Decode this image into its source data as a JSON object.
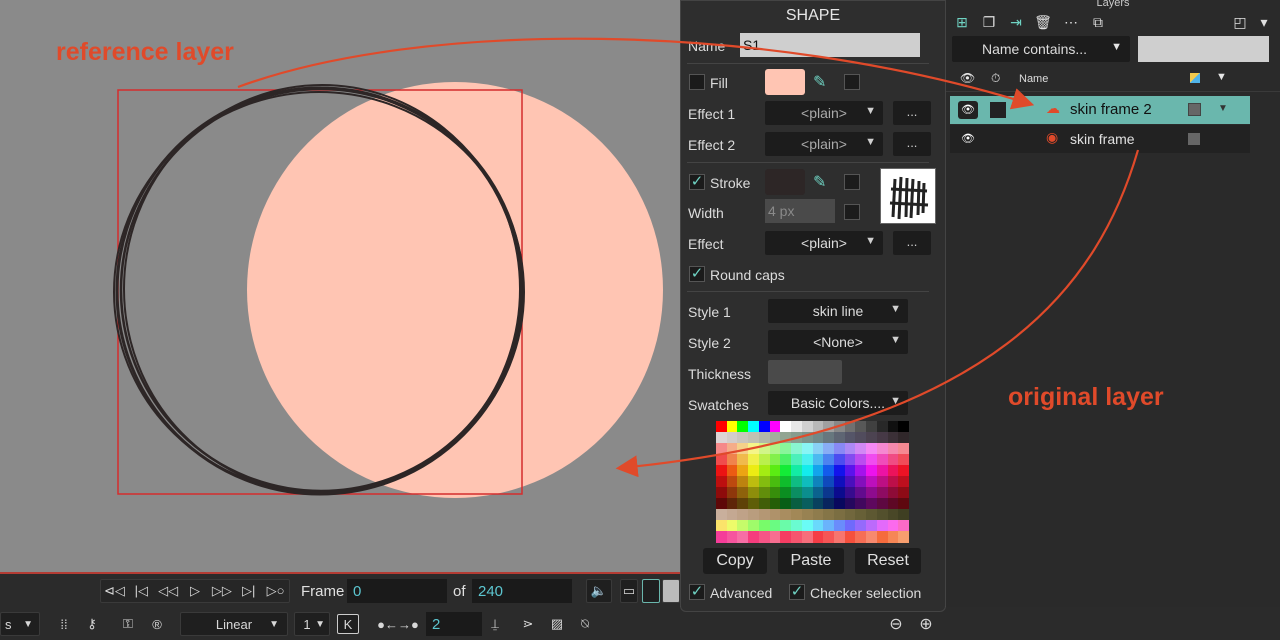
{
  "canvas": {
    "annotation_reference": "reference layer",
    "annotation_original": "original layer"
  },
  "shape_panel": {
    "title": "SHAPE",
    "name_label": "Name",
    "name_value": "S1",
    "fill_label": "Fill",
    "fill_color": "#ffc5b3",
    "fill_checked": false,
    "effect1_label": "Effect 1",
    "effect1_value": "<plain>",
    "effect2_label": "Effect 2",
    "effect2_value": "<plain>",
    "more_label": "...",
    "stroke_label": "Stroke",
    "stroke_checked": true,
    "stroke_color": "#2d2626",
    "width_label": "Width",
    "width_placeholder": "4 px",
    "effect_label": "Effect",
    "effect_value": "<plain>",
    "round_caps_label": "Round caps",
    "style1_label": "Style 1",
    "style1_value": "skin line",
    "style2_label": "Style 2",
    "style2_value": "<None>",
    "thickness_label": "Thickness",
    "swatches_label": "Swatches",
    "swatches_value": "Basic Colors....",
    "copy_label": "Copy",
    "paste_label": "Paste",
    "reset_label": "Reset",
    "advanced_label": "Advanced",
    "checker_label": "Checker selection"
  },
  "layers_panel": {
    "title": "Layers",
    "filter_label": "Name contains...",
    "filter_value": "",
    "name_header": "Name",
    "layers": [
      {
        "name": "skin frame 2",
        "selected": true,
        "accent": "#6ab7ad"
      },
      {
        "name": "skin frame",
        "selected": false
      }
    ]
  },
  "timeline": {
    "frame_label": "Frame",
    "frame_value": "0",
    "of_label": "of",
    "total_frames": "240"
  },
  "bottom_toolbar": {
    "left_label": "s",
    "interpolation": "Linear",
    "step_value": "1",
    "key_label": "K",
    "step_frames": "2"
  },
  "colors": {
    "accent_teal": "#6ab7ad",
    "annotation_red": "#e04a2a",
    "frame_red": "#d42d2d"
  }
}
